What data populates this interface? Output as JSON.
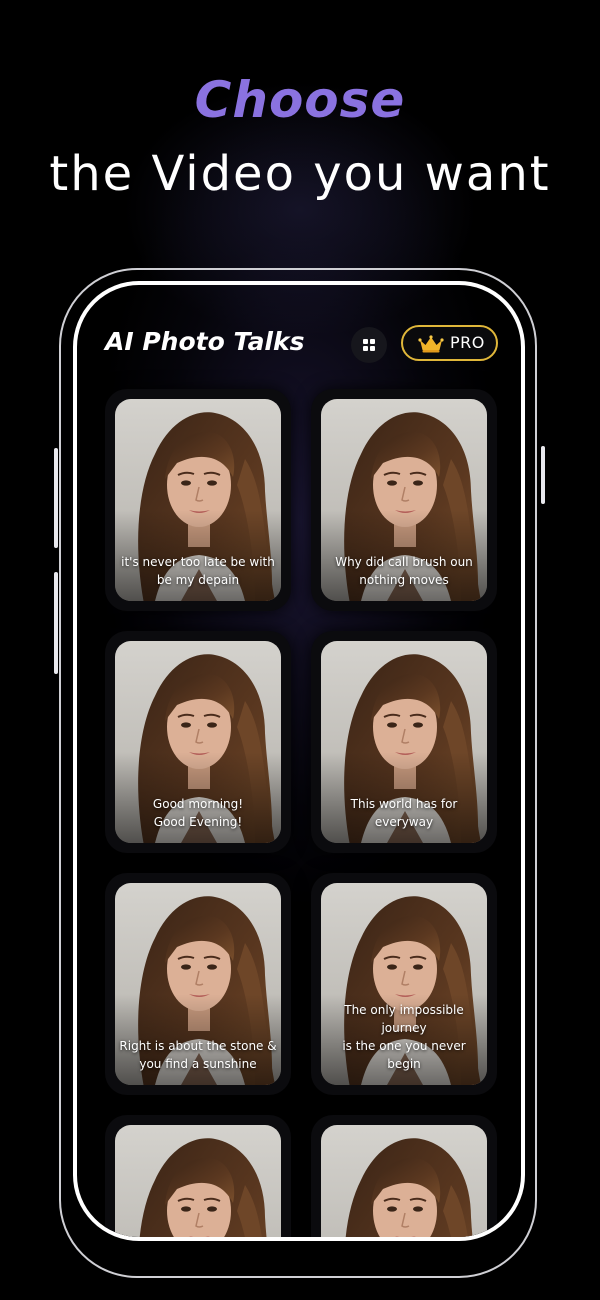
{
  "headline": {
    "line1": "Choose",
    "line2": "the Video you want"
  },
  "app": {
    "title": "AI Photo Talks",
    "grid_icon": "grid-icon",
    "pro_label": "PRO",
    "crown_icon": "crown-icon"
  },
  "colors": {
    "accent": "#8a72e0",
    "pro_border": "#e0b73a",
    "crown": "#f0b429"
  },
  "cards": [
    {
      "caption_line1": "it's never too late be with",
      "caption_line2": "be my depain"
    },
    {
      "caption_line1": "Why did call brush oun",
      "caption_line2": "nothing moves"
    },
    {
      "caption_line1": "Good morning!",
      "caption_line2": "Good Evening!"
    },
    {
      "caption_line1": "This world has for",
      "caption_line2": "everyway"
    },
    {
      "caption_line1": "Right is about the stone &",
      "caption_line2": "you find a sunshine"
    },
    {
      "caption_line1": "The only impossible journey",
      "caption_line2": "is the one you never begin"
    },
    {
      "caption_line1": "",
      "caption_line2": ""
    },
    {
      "caption_line1": "",
      "caption_line2": ""
    }
  ]
}
